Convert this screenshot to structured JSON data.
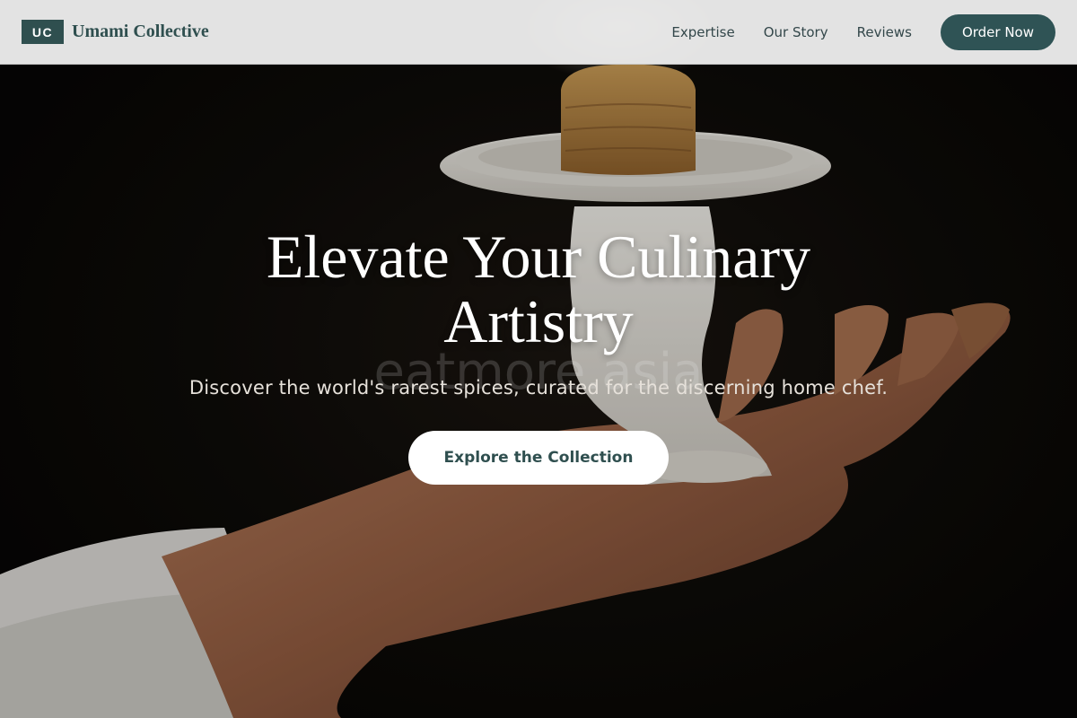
{
  "brand": {
    "badge": "UC",
    "name": "Umami Collective"
  },
  "nav": {
    "links": [
      "Expertise",
      "Our Story",
      "Reviews"
    ],
    "cta": "Order Now"
  },
  "hero": {
    "title": "Elevate Your Culinary Artistry",
    "subtitle": "Discover the world's rarest spices, curated for the discerning home chef.",
    "cta": "Explore the Collection",
    "watermark": "eatmore.asia",
    "image": "chef-hand-holding-pastry-on-pedestal-plate"
  },
  "colors": {
    "brand": "#2f4f4f",
    "nav_bg": "#ececec",
    "hero_text": "#ffffff"
  }
}
